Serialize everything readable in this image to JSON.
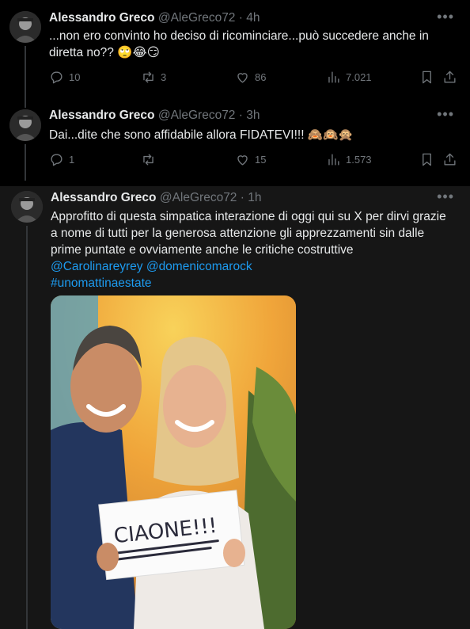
{
  "tweets": [
    {
      "name": "Alessandro Greco",
      "handle": "@AleGreco72",
      "time": "4h",
      "text": "...non ero convinto ho deciso di ricominciare...può succedere anche in diretta no?? 🙄😂😏",
      "replies": "10",
      "retweets": "3",
      "likes": "86",
      "views": "7.021"
    },
    {
      "name": "Alessandro Greco",
      "handle": "@AleGreco72",
      "time": "3h",
      "text": "Dai...dite che sono affidabile allora FIDATEVI!!! 🙈🙉🙊",
      "replies": "1",
      "retweets": "",
      "likes": "15",
      "views": "1.573"
    },
    {
      "name": "Alessandro Greco",
      "handle": "@AleGreco72",
      "time": "1h",
      "text": "Approfitto di questa simpatica interazione di oggi qui su X per dirvi grazie a nome di tutti per la generosa attenzione gli apprezzamenti sin dalle prime puntate e ovviamente anche le critiche costruttive",
      "mentions": "@Carolinareyrey @domenicomarock",
      "hashtag": "#unomattinaestate",
      "photo_sign_text": "CIAONE!!!"
    }
  ],
  "separator": "·",
  "more_icon": "more-horizontal-icon",
  "colors": {
    "background": "#000000",
    "highlight_background": "#161616",
    "text": "#e7e9ea",
    "muted": "#71767b",
    "link": "#1d9bf0"
  }
}
